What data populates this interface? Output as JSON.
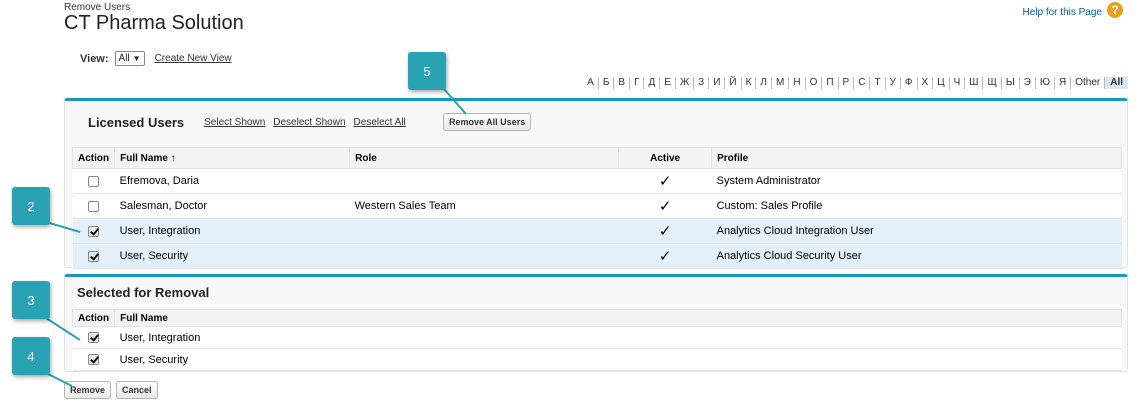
{
  "header": {
    "breadcrumb": "Remove Users",
    "title": "CT Pharma Solution",
    "help_label": "Help for this Page",
    "help_icon": "?"
  },
  "view": {
    "label": "View:",
    "selected": "All",
    "create_link": "Create New View"
  },
  "alphabet": [
    "А",
    "Б",
    "В",
    "Г",
    "Д",
    "Е",
    "Ж",
    "З",
    "И",
    "Й",
    "К",
    "Л",
    "М",
    "Н",
    "О",
    "П",
    "Р",
    "С",
    "Т",
    "У",
    "Ф",
    "Х",
    "Ц",
    "Ч",
    "Ш",
    "Щ",
    "Ы",
    "Э",
    "Ю",
    "Я",
    "Other",
    "All"
  ],
  "licensed": {
    "title": "Licensed Users",
    "select_shown": "Select Shown",
    "deselect_shown": "Deselect Shown",
    "deselect_all": "Deselect All",
    "remove_all": "Remove All Users",
    "columns": [
      "Action",
      "Full Name ↑",
      "Role",
      "Active",
      "Profile"
    ],
    "rows": [
      {
        "checked": false,
        "name": "Efremova, Daria",
        "role": "",
        "active": "✓",
        "profile": "System Administrator"
      },
      {
        "checked": false,
        "name": "Salesman, Doctor",
        "role": "Western Sales Team",
        "active": "✓",
        "profile": "Custom: Sales Profile"
      },
      {
        "checked": true,
        "name": "User, Integration",
        "role": "",
        "active": "✓",
        "profile": "Analytics Cloud Integration User"
      },
      {
        "checked": true,
        "name": "User, Security",
        "role": "",
        "active": "✓",
        "profile": "Analytics Cloud Security User"
      }
    ]
  },
  "removal": {
    "title": "Selected for Removal",
    "columns": [
      "Action",
      "Full Name"
    ],
    "rows": [
      {
        "checked": true,
        "name": "User, Integration"
      },
      {
        "checked": true,
        "name": "User, Security"
      }
    ]
  },
  "buttons": {
    "remove": "Remove",
    "cancel": "Cancel"
  },
  "callouts": {
    "c2": "2",
    "c3": "3",
    "c4": "4",
    "c5": "5"
  },
  "colors": {
    "accent": "#1797c0",
    "callout": "#29a3b3",
    "highlight_row": "#e3f0fa",
    "link": "#015ba7"
  }
}
